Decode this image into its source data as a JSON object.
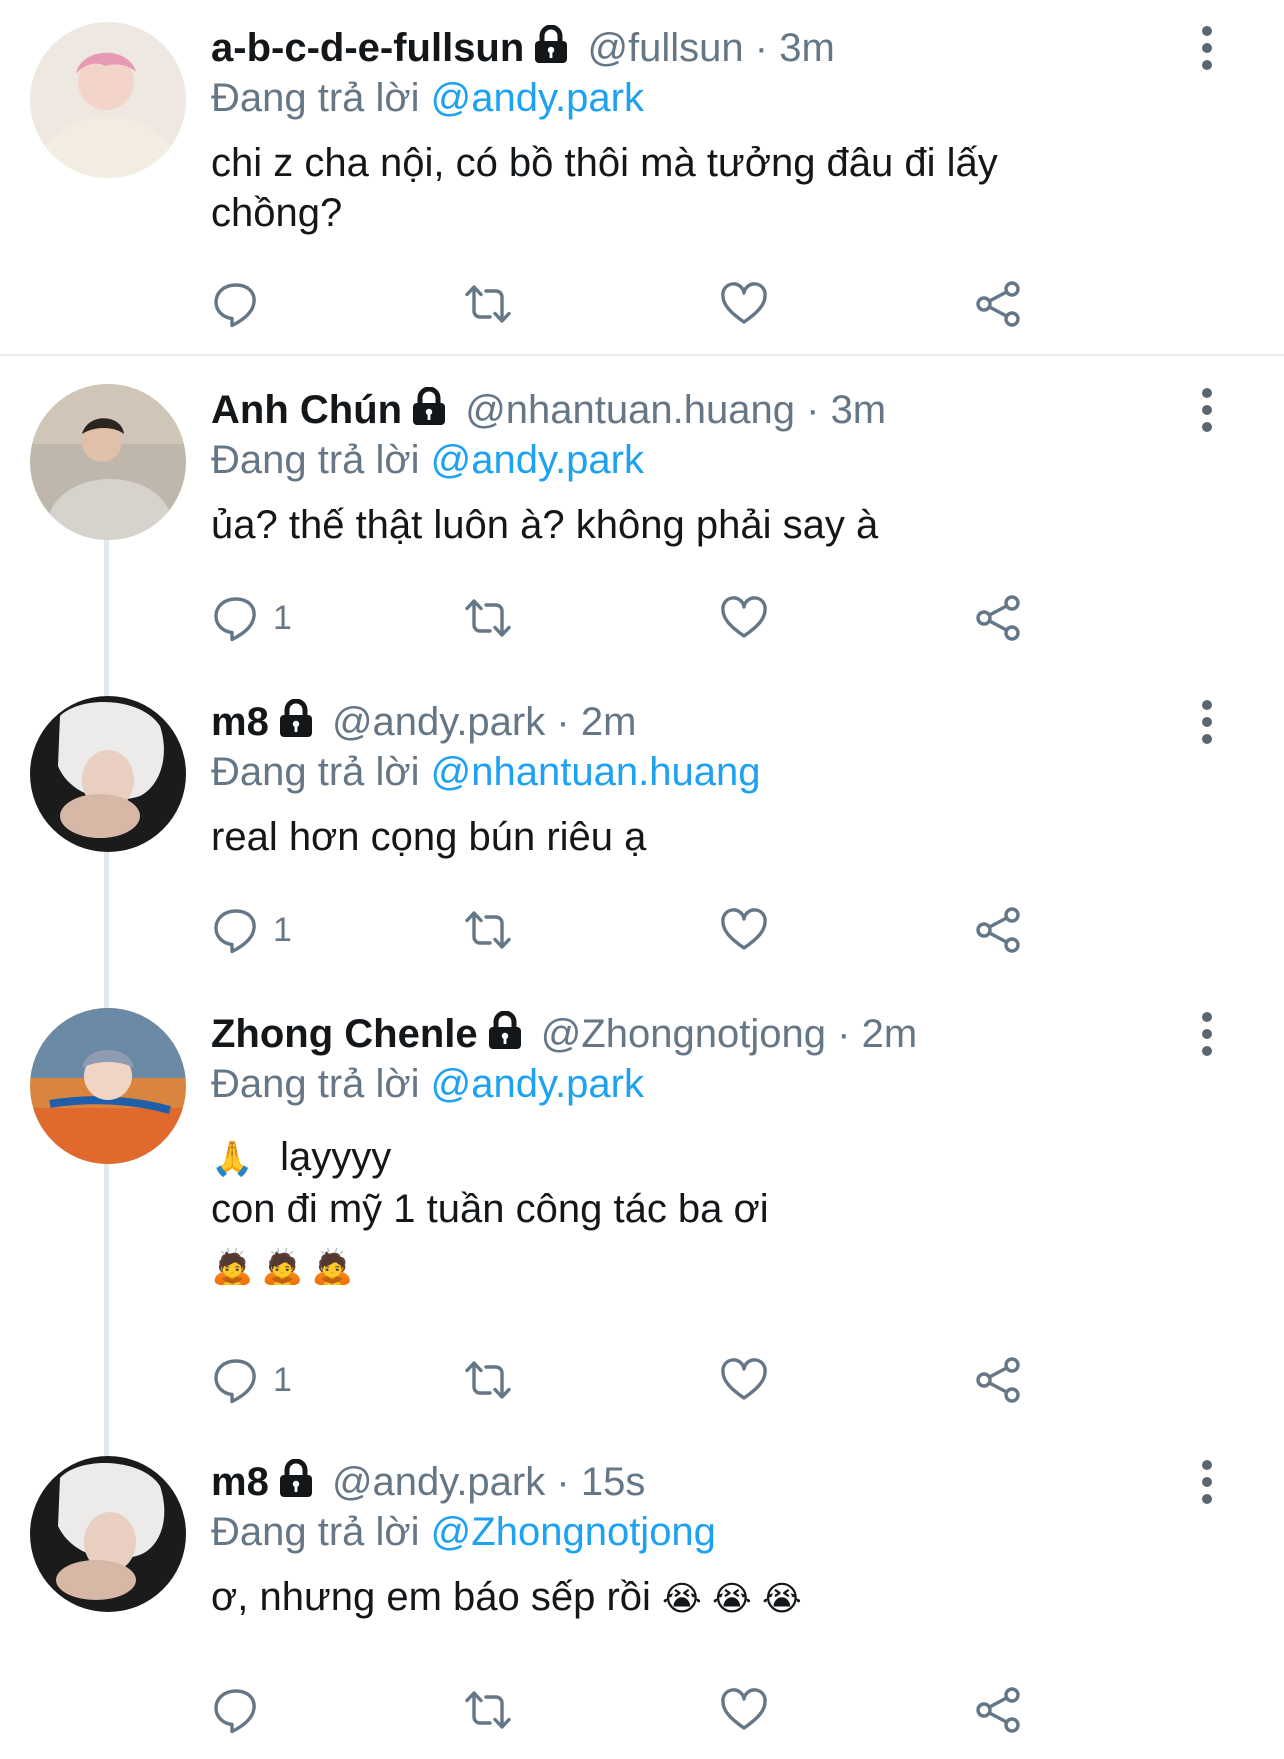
{
  "reply_prefix": "Đang trả lời",
  "dot": "·",
  "tweets": [
    {
      "name": "a-b-c-d-e-fullsun",
      "handle": "@fullsun",
      "time": "3m",
      "reply_to": "@andy.park",
      "text": "chi z cha nội, có bồ thôi mà tưởng đâu đi lấy chồng?",
      "reply_count": ""
    },
    {
      "name": "Anh Chún",
      "handle": "@nhantuan.huang",
      "time": "3m",
      "reply_to": "@andy.park",
      "text": "ủa? thế thật luôn à? không phải say à",
      "reply_count": "1"
    },
    {
      "name": "m8",
      "handle": "@andy.park",
      "time": "2m",
      "reply_to": "@nhantuan.huang",
      "text": "real hơn cọng bún riêu ạ",
      "reply_count": "1"
    },
    {
      "name": "Zhong Chenle",
      "handle": "@Zhongnotjong",
      "time": "2m",
      "reply_to": "@andy.park",
      "text_line1": "lạyyyy",
      "text_line2": "con đi mỹ 1 tuần công tác ba ơi",
      "emoji_pray": "🙏",
      "emoji_bow": "🙇",
      "reply_count": "1"
    },
    {
      "name": "m8",
      "handle": "@andy.park",
      "time": "15s",
      "reply_to": "@Zhongnotjong",
      "text": "ơ, nhưng em báo sếp rồi",
      "emoji_cry": "😭",
      "reply_count": ""
    }
  ],
  "icons": [
    "lock-icon",
    "reply-icon",
    "retweet-icon",
    "like-icon",
    "share-icon",
    "more-icon"
  ],
  "colors": {
    "link": "#1da1f2",
    "secondary": "#657786",
    "thread": "#e1e8ed"
  }
}
